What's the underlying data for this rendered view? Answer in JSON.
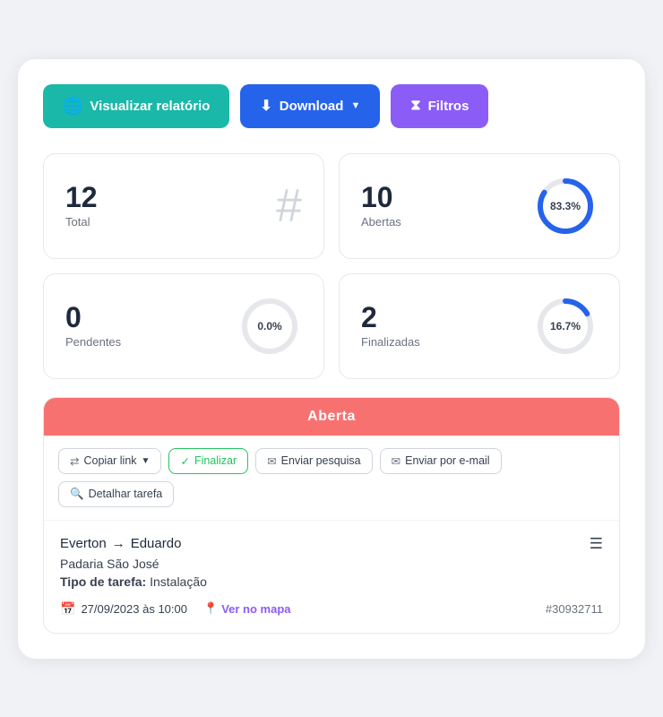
{
  "toolbar": {
    "visualizar_label": "Visualizar relatório",
    "download_label": "Download",
    "filtros_label": "Filtros"
  },
  "stats": {
    "total": {
      "number": "12",
      "label": "Total"
    },
    "abertas": {
      "number": "10",
      "label": "Abertas",
      "percent": "83.3%",
      "percent_value": 83.3,
      "color": "#2563eb"
    },
    "pendentes": {
      "number": "0",
      "label": "Pendentes",
      "percent": "0.0%",
      "percent_value": 0,
      "color": "#d1d5db"
    },
    "finalizadas": {
      "number": "2",
      "label": "Finalizadas",
      "percent": "16.7%",
      "percent_value": 16.7,
      "color": "#2563eb"
    }
  },
  "task": {
    "status": "Aberta",
    "actions": {
      "copy_link": "Copiar link",
      "finalizar": "Finalizar",
      "enviar_pesquisa": "Enviar pesquisa",
      "enviar_email": "Enviar por e-mail",
      "detalhar_tarefa": "Detalhar tarefa"
    },
    "from": "Everton",
    "arrow": "→",
    "to": "Eduardo",
    "company": "Padaria São José",
    "tipo_label": "Tipo de tarefa:",
    "tipo_value": "Instalação",
    "date": "27/09/2023 às 10:00",
    "map_link": "Ver no mapa",
    "task_id": "#30932711"
  }
}
